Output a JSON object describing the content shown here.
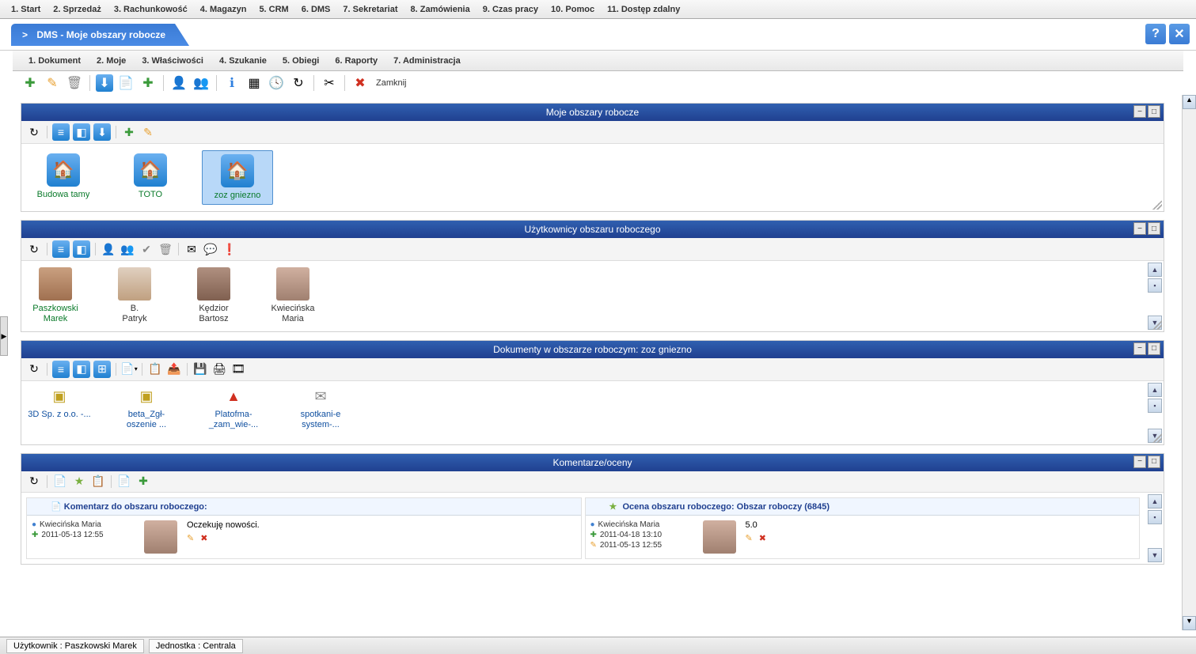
{
  "main_menu": [
    "1. Start",
    "2. Sprzedaż",
    "3. Rachunkowość",
    "4. Magazyn",
    "5. CRM",
    "6. DMS",
    "7. Sekretariat",
    "8. Zamówienia",
    "9. Czas pracy",
    "10. Pomoc",
    "11. Dostęp zdalny"
  ],
  "tab": {
    "title": "DMS - Moje obszary robocze"
  },
  "sub_menu": [
    "1. Dokument",
    "2. Moje",
    "3. Właściwości",
    "4. Szukanie",
    "5. Obiegi",
    "6. Raporty",
    "7. Administracja"
  ],
  "toolbar": {
    "close": "Zamknij"
  },
  "panels": {
    "workspaces": {
      "title": "Moje obszary robocze",
      "items": [
        {
          "label": "Budowa tamy",
          "selected": false
        },
        {
          "label": "TOTO",
          "selected": false
        },
        {
          "label": "zoz gniezno",
          "selected": true
        }
      ]
    },
    "users": {
      "title": "Użytkownicy obszaru roboczego",
      "items": [
        {
          "line1": "Paszkowski",
          "line2": "Marek",
          "owner": true
        },
        {
          "line1": "B.",
          "line2": "Patryk",
          "owner": false
        },
        {
          "line1": "Kędzior",
          "line2": "Bartosz",
          "owner": false
        },
        {
          "line1": "Kwiecińska",
          "line2": "Maria",
          "owner": false
        }
      ]
    },
    "documents": {
      "title": "Dokumenty w obszarze roboczym: zoz gniezno",
      "items": [
        {
          "label": "3D Sp. z o.o. -...",
          "icon": "isof"
        },
        {
          "label": "beta_Zgł-oszenie ...",
          "icon": "isof"
        },
        {
          "label": "Platofma-_zam_wie-...",
          "icon": "pdf"
        },
        {
          "label": "spotkani-e system-...",
          "icon": "mail"
        }
      ]
    },
    "comments": {
      "title": "Komentarze/oceny",
      "left": {
        "header": "Komentarz do obszaru roboczego:",
        "author": "Kwiecińska Maria",
        "date": "2011-05-13 12:55",
        "text": "Oczekuję nowości."
      },
      "right": {
        "header": "Ocena obszaru roboczego: Obszar roboczy (6845)",
        "author": "Kwiecińska Maria",
        "date1": "2011-04-18 13:10",
        "date2": "2011-05-13 12:55",
        "score": "5.0"
      }
    }
  },
  "footer": {
    "user": "Użytkownik : Paszkowski Marek",
    "unit": "Jednostka : Centrala"
  }
}
